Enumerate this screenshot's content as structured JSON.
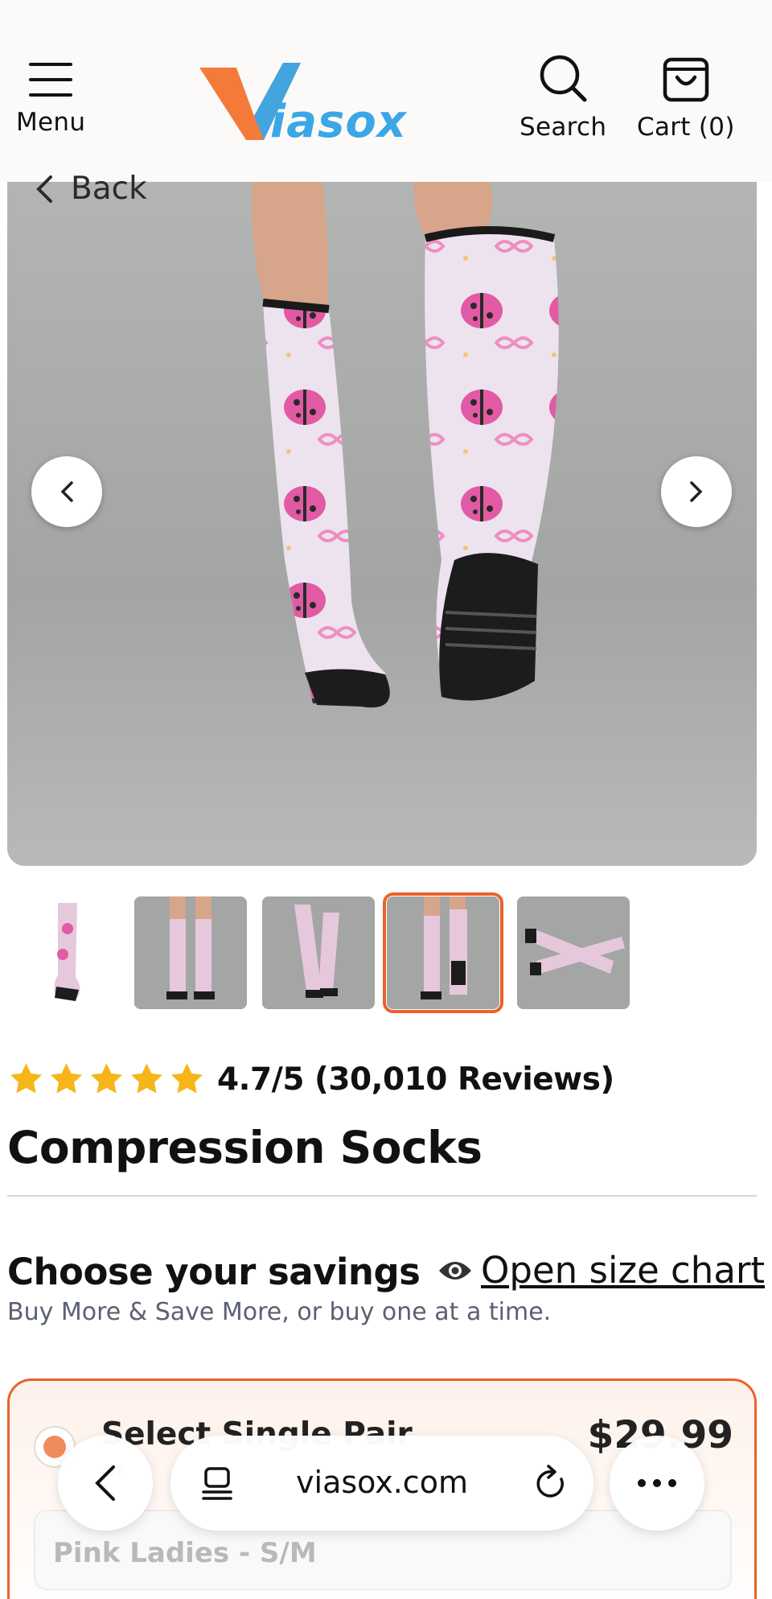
{
  "header": {
    "menu_label": "Menu",
    "brand": "Viasox",
    "search_label": "Search",
    "cart_label": "Cart (0)"
  },
  "back_label": "Back",
  "gallery": {
    "selected_index": 3,
    "thumbnail_count": 5
  },
  "rating": {
    "stars": 5,
    "text": "4.7/5 (30,010 Reviews)"
  },
  "product": {
    "title": "Compression Socks"
  },
  "savings": {
    "heading": "Choose your savings",
    "size_chart_label": "Open size chart",
    "subtext": "Buy More & Save More, or buy one at a time."
  },
  "offer": {
    "title": "Select Single Pair",
    "price": "$29.99",
    "hint": "or",
    "variant": "Pink Ladies - S/M"
  },
  "browser": {
    "url": "viasox.com"
  },
  "colors": {
    "accent": "#e8632c",
    "star": "#f6b519",
    "logo_orange": "#f47a3a",
    "logo_blue": "#3aa7e6"
  }
}
